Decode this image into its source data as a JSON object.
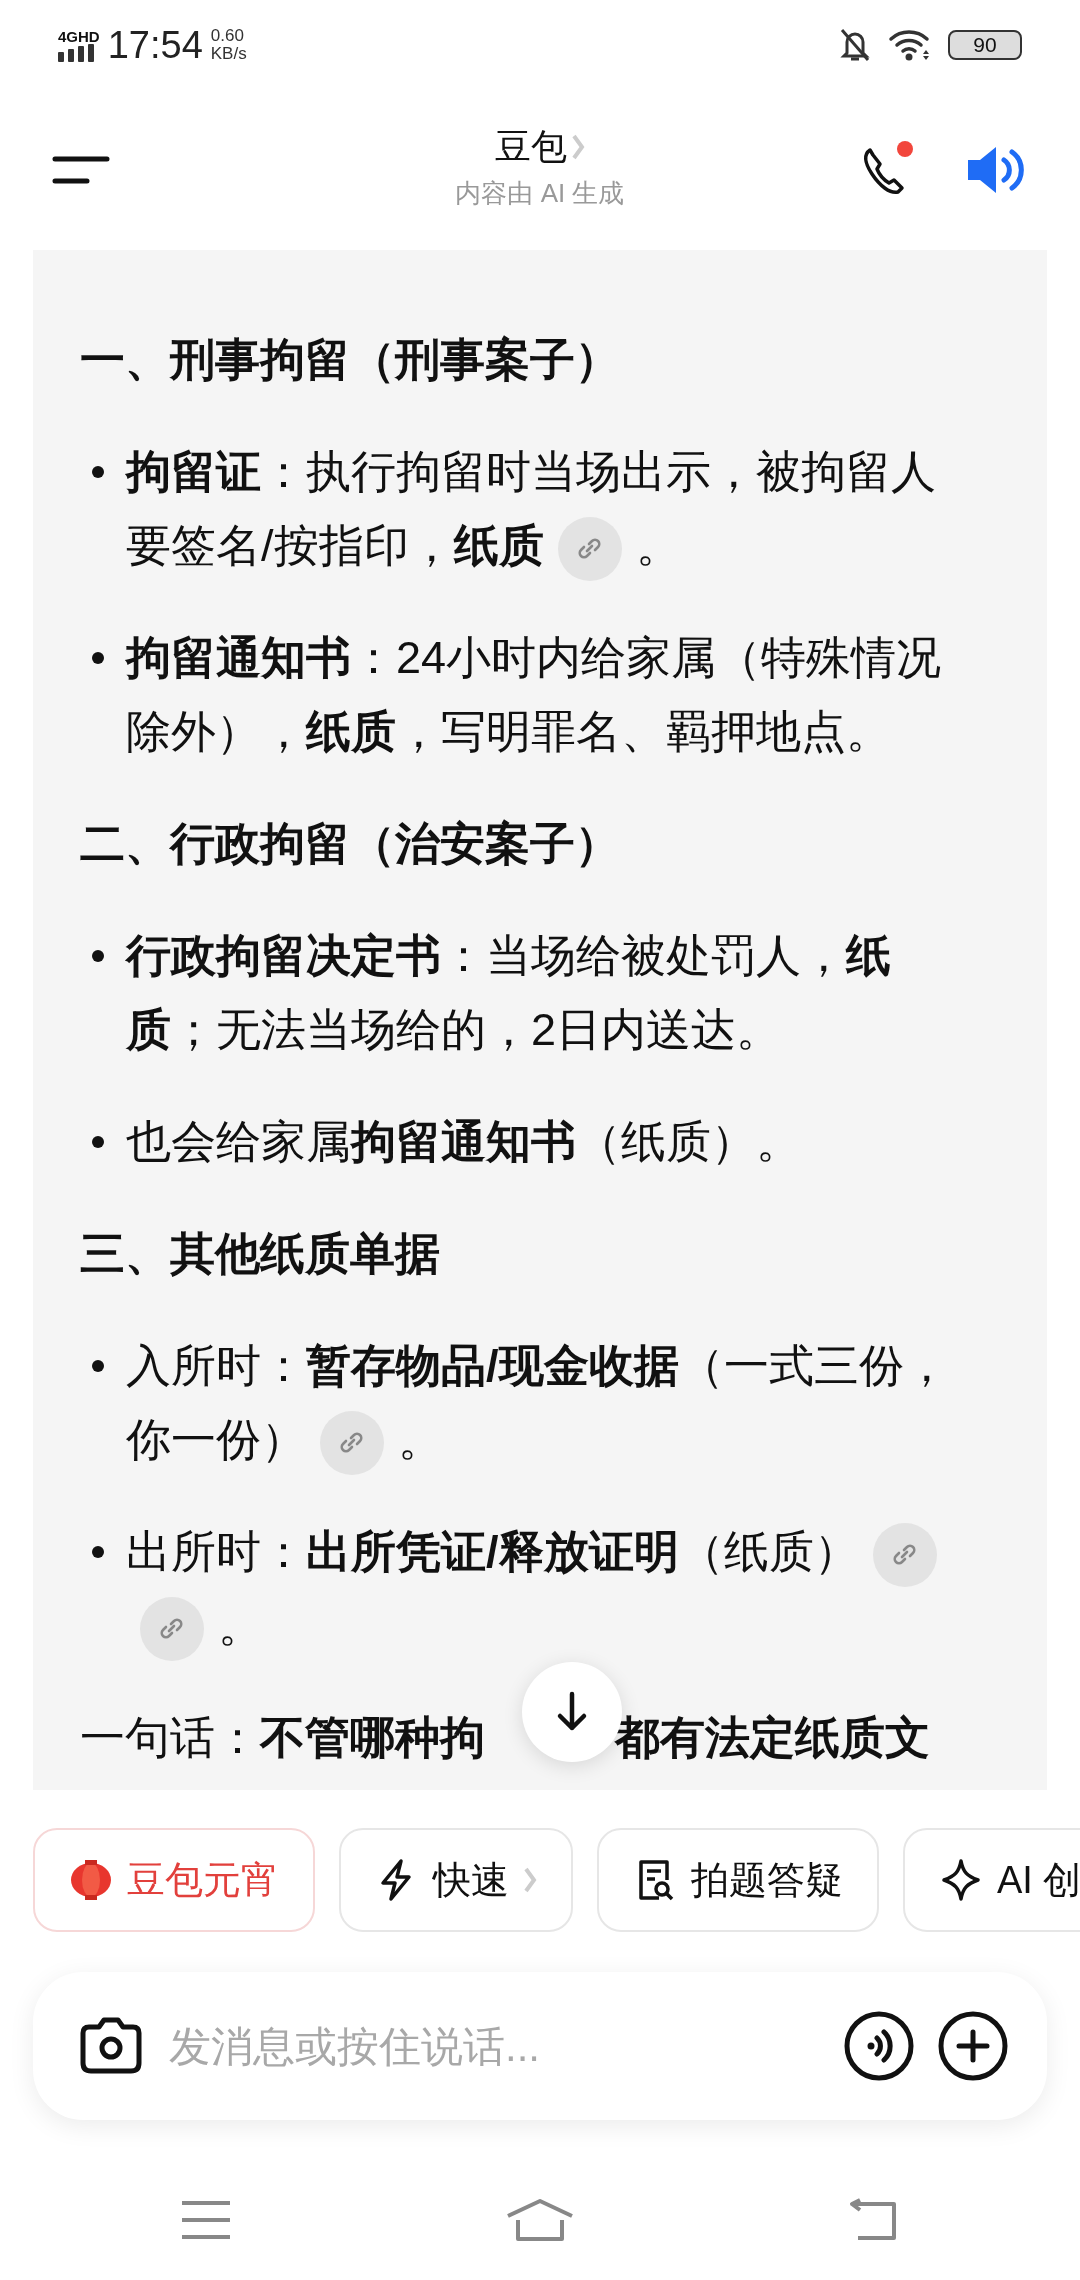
{
  "status_bar": {
    "network": "4GHD",
    "time": "17:54",
    "speed_value": "0.60",
    "speed_unit": "KB/s",
    "battery": "90"
  },
  "header": {
    "title": "豆包",
    "subtitle": "内容由 AI 生成"
  },
  "message": [
    {
      "kind": "heading",
      "segments": [
        {
          "kind": "text",
          "text": "一、刑事拘留（刑事案子）"
        }
      ]
    },
    {
      "kind": "bullet",
      "segments": [
        {
          "kind": "text",
          "text": "**拘留证**：执行拘留时当场出示，被拘留人要签名/按指印，**纸质**"
        },
        {
          "kind": "link"
        },
        {
          "kind": "text",
          "text": "。"
        }
      ]
    },
    {
      "kind": "bullet",
      "segments": [
        {
          "kind": "text",
          "text": "**拘留通知书**：24小时内给家属（特殊情况除外），**纸质**，写明罪名、羁押地点。"
        }
      ]
    },
    {
      "kind": "heading",
      "segments": [
        {
          "kind": "text",
          "text": "二、行政拘留（治安案子）"
        }
      ]
    },
    {
      "kind": "bullet",
      "segments": [
        {
          "kind": "text",
          "text": "**行政拘留决定书**：当场给被处罚人，**纸质**；无法当场给的，2日内送达。"
        }
      ]
    },
    {
      "kind": "bullet",
      "segments": [
        {
          "kind": "text",
          "text": "也会给家属**拘留通知书**（纸质）。"
        }
      ]
    },
    {
      "kind": "heading",
      "segments": [
        {
          "kind": "text",
          "text": "三、其他纸质单据"
        }
      ]
    },
    {
      "kind": "bullet",
      "segments": [
        {
          "kind": "text",
          "text": "入所时：**暂存物品/现金收据**（一式三份，你一份）"
        },
        {
          "kind": "link"
        },
        {
          "kind": "text",
          "text": "。"
        }
      ]
    },
    {
      "kind": "bullet",
      "segments": [
        {
          "kind": "text",
          "text": "出所时：**出所凭证/释放证明**（纸质）"
        },
        {
          "kind": "link"
        },
        {
          "kind": "link"
        },
        {
          "kind": "text",
          "text": "。"
        }
      ]
    },
    {
      "kind": "paragraph",
      "segments": [
        {
          "kind": "text",
          "text": "一句话：**不管哪种拘**"
        },
        {
          "kind": "gap"
        },
        {
          "kind": "text",
          "text": "**都有法定纸质文**"
        }
      ]
    }
  ],
  "chips": [
    {
      "label": "豆包元宵",
      "accent": true,
      "chevron": false
    },
    {
      "label": "快速",
      "accent": false,
      "chevron": true
    },
    {
      "label": "拍题答疑",
      "accent": false,
      "chevron": false
    },
    {
      "label": "AI 创",
      "accent": false,
      "chevron": false
    }
  ],
  "composer": {
    "placeholder": "发消息或按住说话..."
  }
}
